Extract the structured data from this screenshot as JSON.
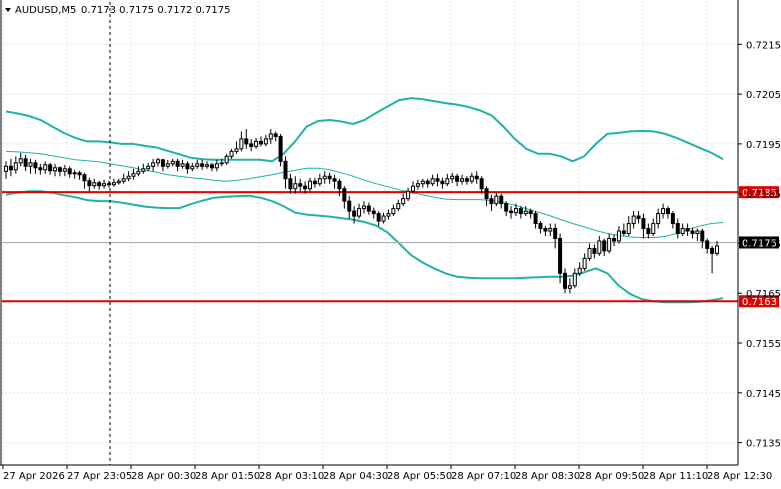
{
  "header": {
    "symbol": "AUDUSD,M5",
    "ohlc": "0.7173 0.7175 0.7172 0.7175"
  },
  "colors": {
    "background": "#ffffff",
    "grid": "#c8c8c8",
    "candle": "#000000",
    "band": "#20b2aa",
    "level": "#e00000",
    "current_bg": "#000000"
  },
  "chart_data": {
    "type": "candlestick",
    "grid": true,
    "ylim": [
      0.71305,
      0.72235
    ],
    "y_ticks": [
      "0.7215",
      "0.7205",
      "0.7195",
      "0.7185",
      "0.7175",
      "0.7165",
      "0.7155",
      "0.7145",
      "0.7135"
    ],
    "x_tick_labels": [
      "27 Apr 2026",
      "27 Apr 23:05",
      "28 Apr 00:30",
      "28 Apr 01:50",
      "28 Apr 03:10",
      "28 Apr 04:30",
      "28 Apr 05:50",
      "28 Apr 07:10",
      "28 Apr 08:30",
      "28 Apr 09:50",
      "28 Apr 11:10",
      "28 Apr 12:30"
    ],
    "levels": [
      {
        "label": "0.7185",
        "value": 0.71853
      },
      {
        "label": "0.7163",
        "value": 0.71634
      }
    ],
    "current_price": {
      "label": "0.7175",
      "value": 0.71752
    },
    "bollinger": {
      "upper": [
        0.72015,
        0.72011,
        0.72006,
        0.71998,
        0.71985,
        0.71972,
        0.71962,
        0.71955,
        0.71955,
        0.71953,
        0.7195,
        0.7195,
        0.71946,
        0.71943,
        0.71936,
        0.71929,
        0.71922,
        0.71919,
        0.71918,
        0.71918,
        0.71918,
        0.71918,
        0.71918,
        0.71915,
        0.7193,
        0.71955,
        0.71985,
        0.71996,
        0.71998,
        0.71995,
        0.7199,
        0.71998,
        0.72012,
        0.72025,
        0.72038,
        0.72042,
        0.7204,
        0.72036,
        0.72032,
        0.72029,
        0.72024,
        0.72017,
        0.72007,
        0.71985,
        0.7196,
        0.7194,
        0.7193,
        0.7193,
        0.71925,
        0.71915,
        0.71925,
        0.7195,
        0.7197,
        0.71972,
        0.71975,
        0.71976,
        0.71975,
        0.7197,
        0.71962,
        0.71952,
        0.71942,
        0.71932,
        0.71919
      ],
      "middle": [
        0.71935,
        0.71934,
        0.71932,
        0.7193,
        0.71926,
        0.71922,
        0.71918,
        0.71916,
        0.71914,
        0.7191,
        0.71906,
        0.71902,
        0.71897,
        0.71893,
        0.71888,
        0.71885,
        0.71882,
        0.7188,
        0.71877,
        0.71875,
        0.71877,
        0.7188,
        0.71884,
        0.71888,
        0.71893,
        0.71897,
        0.71901,
        0.71901,
        0.71898,
        0.71892,
        0.71885,
        0.71877,
        0.7187,
        0.71864,
        0.71858,
        0.71853,
        0.71848,
        0.71843,
        0.71839,
        0.71838,
        0.71838,
        0.71838,
        0.71836,
        0.71832,
        0.71827,
        0.7182,
        0.71813,
        0.71806,
        0.71798,
        0.7179,
        0.71783,
        0.71776,
        0.7177,
        0.71766,
        0.71763,
        0.71762,
        0.71762,
        0.71764,
        0.7177,
        0.71778,
        0.71785,
        0.7179,
        0.71792
      ],
      "lower": [
        0.71848,
        0.71852,
        0.71855,
        0.71855,
        0.71852,
        0.71847,
        0.71843,
        0.71837,
        0.71835,
        0.71835,
        0.71832,
        0.71828,
        0.71824,
        0.71822,
        0.71821,
        0.71821,
        0.71829,
        0.71836,
        0.71842,
        0.71844,
        0.71845,
        0.71846,
        0.71842,
        0.71835,
        0.71825,
        0.71812,
        0.71808,
        0.71806,
        0.71804,
        0.71801,
        0.71798,
        0.71793,
        0.71786,
        0.71772,
        0.7175,
        0.71727,
        0.71712,
        0.717,
        0.7169,
        0.71683,
        0.71681,
        0.7168,
        0.7168,
        0.7168,
        0.7168,
        0.71681,
        0.71682,
        0.71683,
        0.71683,
        0.71685,
        0.71692,
        0.717,
        0.7169,
        0.71665,
        0.71648,
        0.71638,
        0.71634,
        0.71632,
        0.71632,
        0.71632,
        0.71633,
        0.71636,
        0.7164
      ]
    },
    "candles": [
      [
        0.71895,
        0.71905,
        0.71915,
        0.7188
      ],
      [
        0.71905,
        0.71898,
        0.7192,
        0.71885
      ],
      [
        0.71898,
        0.71912,
        0.71925,
        0.7189
      ],
      [
        0.71912,
        0.7192,
        0.71932,
        0.71905
      ],
      [
        0.7192,
        0.71905,
        0.71928,
        0.71895
      ],
      [
        0.71905,
        0.71912,
        0.7192,
        0.7189
      ],
      [
        0.71912,
        0.71902,
        0.71918,
        0.7189
      ],
      [
        0.71902,
        0.71898,
        0.7191,
        0.71888
      ],
      [
        0.71898,
        0.71908,
        0.71915,
        0.7189
      ],
      [
        0.71908,
        0.71896,
        0.71912,
        0.71888
      ],
      [
        0.71896,
        0.71902,
        0.7191,
        0.71885
      ],
      [
        0.71902,
        0.71895,
        0.71905,
        0.71885
      ],
      [
        0.71895,
        0.719,
        0.71908,
        0.71885
      ],
      [
        0.719,
        0.7189,
        0.71905,
        0.71882
      ],
      [
        0.7189,
        0.71892,
        0.71898,
        0.7188
      ],
      [
        0.71892,
        0.71888,
        0.71896,
        0.71878
      ],
      [
        0.71888,
        0.71876,
        0.71892,
        0.7186
      ],
      [
        0.71876,
        0.71866,
        0.71882,
        0.71855
      ],
      [
        0.71866,
        0.71872,
        0.7188,
        0.7186
      ],
      [
        0.71872,
        0.71866,
        0.71876,
        0.71858
      ],
      [
        0.71866,
        0.7187,
        0.71878,
        0.7186
      ],
      [
        0.7187,
        0.71868,
        0.71876,
        0.71862
      ],
      [
        0.71868,
        0.71872,
        0.7188,
        0.71864
      ],
      [
        0.71872,
        0.71875,
        0.7188,
        0.71868
      ],
      [
        0.71875,
        0.7188,
        0.7189,
        0.7187
      ],
      [
        0.7188,
        0.71885,
        0.71895,
        0.71875
      ],
      [
        0.71885,
        0.7189,
        0.719,
        0.71878
      ],
      [
        0.7189,
        0.71895,
        0.71905,
        0.71885
      ],
      [
        0.71895,
        0.719,
        0.7191,
        0.7189
      ],
      [
        0.719,
        0.71905,
        0.71912,
        0.71895
      ],
      [
        0.71905,
        0.71912,
        0.7192,
        0.71895
      ],
      [
        0.71912,
        0.71918,
        0.71922,
        0.71905
      ],
      [
        0.71918,
        0.71905,
        0.7192,
        0.71895
      ],
      [
        0.71905,
        0.7191,
        0.71918,
        0.719
      ],
      [
        0.7191,
        0.71915,
        0.7192,
        0.71905
      ],
      [
        0.71915,
        0.71905,
        0.7192,
        0.71895
      ],
      [
        0.71905,
        0.7191,
        0.71918,
        0.719
      ],
      [
        0.7191,
        0.719,
        0.71915,
        0.7189
      ],
      [
        0.719,
        0.71905,
        0.71912,
        0.71895
      ],
      [
        0.71905,
        0.7191,
        0.71918,
        0.719
      ],
      [
        0.7191,
        0.71905,
        0.71918,
        0.71898
      ],
      [
        0.71905,
        0.71908,
        0.71915,
        0.719
      ],
      [
        0.71908,
        0.71902,
        0.71912,
        0.71895
      ],
      [
        0.71902,
        0.7191,
        0.71918,
        0.71895
      ],
      [
        0.7191,
        0.71912,
        0.7192,
        0.71905
      ],
      [
        0.71912,
        0.71925,
        0.7193,
        0.71908
      ],
      [
        0.71925,
        0.71935,
        0.7194,
        0.7192
      ],
      [
        0.71935,
        0.7194,
        0.71955,
        0.7193
      ],
      [
        0.7194,
        0.7196,
        0.71975,
        0.71935
      ],
      [
        0.7196,
        0.7195,
        0.7198,
        0.7194
      ],
      [
        0.7195,
        0.71945,
        0.7196,
        0.71935
      ],
      [
        0.71945,
        0.71955,
        0.71962,
        0.7194
      ],
      [
        0.71955,
        0.7195,
        0.71965,
        0.71945
      ],
      [
        0.7195,
        0.7196,
        0.71968,
        0.71945
      ],
      [
        0.7196,
        0.7197,
        0.7198,
        0.7195
      ],
      [
        0.7197,
        0.71965,
        0.71975,
        0.71955
      ],
      [
        0.71965,
        0.71915,
        0.7197,
        0.71905
      ],
      [
        0.71915,
        0.7188,
        0.71925,
        0.7186
      ],
      [
        0.7188,
        0.7186,
        0.7189,
        0.7185
      ],
      [
        0.7186,
        0.7187,
        0.71885,
        0.7185
      ],
      [
        0.7187,
        0.71865,
        0.7188,
        0.71855
      ],
      [
        0.71865,
        0.7186,
        0.71875,
        0.7185
      ],
      [
        0.7186,
        0.71875,
        0.71882,
        0.71855
      ],
      [
        0.71875,
        0.7187,
        0.71882,
        0.71862
      ],
      [
        0.7187,
        0.7188,
        0.7189,
        0.71865
      ],
      [
        0.7188,
        0.71885,
        0.71895,
        0.7187
      ],
      [
        0.71885,
        0.7188,
        0.71892,
        0.7187
      ],
      [
        0.7188,
        0.71875,
        0.71888,
        0.7186
      ],
      [
        0.71875,
        0.7186,
        0.7188,
        0.71845
      ],
      [
        0.7186,
        0.71835,
        0.71865,
        0.7182
      ],
      [
        0.71835,
        0.71815,
        0.71845,
        0.718
      ],
      [
        0.71815,
        0.71805,
        0.71825,
        0.7179
      ],
      [
        0.71805,
        0.7182,
        0.7183,
        0.718
      ],
      [
        0.7182,
        0.71825,
        0.71835,
        0.7181
      ],
      [
        0.71825,
        0.71815,
        0.71832,
        0.71808
      ],
      [
        0.71815,
        0.7181,
        0.71822,
        0.718
      ],
      [
        0.7181,
        0.71795,
        0.71815,
        0.71785
      ],
      [
        0.71795,
        0.71805,
        0.71812,
        0.7179
      ],
      [
        0.71805,
        0.7181,
        0.71818,
        0.71798
      ],
      [
        0.7181,
        0.7182,
        0.71828,
        0.71805
      ],
      [
        0.7182,
        0.7183,
        0.71838,
        0.71815
      ],
      [
        0.7183,
        0.7184,
        0.7185,
        0.71825
      ],
      [
        0.7184,
        0.71855,
        0.71862,
        0.71835
      ],
      [
        0.71855,
        0.71865,
        0.71875,
        0.7185
      ],
      [
        0.71865,
        0.7187,
        0.71878,
        0.71858
      ],
      [
        0.7187,
        0.71875,
        0.7188,
        0.71862
      ],
      [
        0.71875,
        0.7187,
        0.7188,
        0.71862
      ],
      [
        0.7187,
        0.7188,
        0.71888,
        0.71865
      ],
      [
        0.7188,
        0.71875,
        0.7189,
        0.71865
      ],
      [
        0.71875,
        0.7187,
        0.71882,
        0.7186
      ],
      [
        0.7187,
        0.7188,
        0.7189,
        0.71865
      ],
      [
        0.7188,
        0.71885,
        0.71892,
        0.71872
      ],
      [
        0.71885,
        0.71875,
        0.7189,
        0.71865
      ],
      [
        0.71875,
        0.7188,
        0.71888,
        0.71868
      ],
      [
        0.7188,
        0.71875,
        0.71885,
        0.71868
      ],
      [
        0.71875,
        0.71885,
        0.71892,
        0.7187
      ],
      [
        0.71885,
        0.7188,
        0.71895,
        0.7187
      ],
      [
        0.7188,
        0.7186,
        0.71885,
        0.7185
      ],
      [
        0.7186,
        0.7184,
        0.71865,
        0.71825
      ],
      [
        0.7184,
        0.7183,
        0.71848,
        0.71815
      ],
      [
        0.7183,
        0.71845,
        0.71852,
        0.71825
      ],
      [
        0.71845,
        0.7183,
        0.7185,
        0.7182
      ],
      [
        0.7183,
        0.71815,
        0.71835,
        0.71805
      ],
      [
        0.71815,
        0.71812,
        0.71825,
        0.718
      ],
      [
        0.71812,
        0.7182,
        0.7183,
        0.71805
      ],
      [
        0.7182,
        0.7181,
        0.71825,
        0.718
      ],
      [
        0.7181,
        0.71815,
        0.71825,
        0.71805
      ],
      [
        0.71815,
        0.7181,
        0.7182,
        0.718
      ],
      [
        0.7181,
        0.7179,
        0.71815,
        0.7178
      ],
      [
        0.7179,
        0.7178,
        0.71795,
        0.7177
      ],
      [
        0.7178,
        0.71775,
        0.71785,
        0.71765
      ],
      [
        0.71775,
        0.7178,
        0.7179,
        0.71765
      ],
      [
        0.7178,
        0.7176,
        0.7179,
        0.7174
      ],
      [
        0.7176,
        0.7169,
        0.7177,
        0.7167
      ],
      [
        0.7169,
        0.7166,
        0.717,
        0.7165
      ],
      [
        0.7166,
        0.71665,
        0.7168,
        0.7165
      ],
      [
        0.71665,
        0.7169,
        0.717,
        0.7166
      ],
      [
        0.7169,
        0.717,
        0.71712,
        0.71685
      ],
      [
        0.717,
        0.7172,
        0.7173,
        0.71695
      ],
      [
        0.7172,
        0.7174,
        0.7175,
        0.71715
      ],
      [
        0.7174,
        0.7173,
        0.71748,
        0.7172
      ],
      [
        0.7173,
        0.71755,
        0.71765,
        0.71725
      ],
      [
        0.71755,
        0.71735,
        0.7176,
        0.71725
      ],
      [
        0.71735,
        0.7176,
        0.7177,
        0.7173
      ],
      [
        0.7176,
        0.71755,
        0.71768,
        0.71745
      ],
      [
        0.71755,
        0.71775,
        0.71785,
        0.7175
      ],
      [
        0.71775,
        0.7177,
        0.7179,
        0.71765
      ],
      [
        0.7177,
        0.7179,
        0.71805,
        0.71765
      ],
      [
        0.7179,
        0.71805,
        0.71815,
        0.7178
      ],
      [
        0.71805,
        0.718,
        0.71815,
        0.7179
      ],
      [
        0.718,
        0.7178,
        0.7181,
        0.7176
      ],
      [
        0.7178,
        0.7177,
        0.7179,
        0.7176
      ],
      [
        0.7177,
        0.7179,
        0.718,
        0.71765
      ],
      [
        0.7179,
        0.7181,
        0.7182,
        0.7178
      ],
      [
        0.7181,
        0.7182,
        0.7183,
        0.718
      ],
      [
        0.7182,
        0.7181,
        0.71825,
        0.718
      ],
      [
        0.7181,
        0.7179,
        0.71815,
        0.7178
      ],
      [
        0.7179,
        0.7177,
        0.718,
        0.7176
      ],
      [
        0.7177,
        0.7178,
        0.7179,
        0.71765
      ],
      [
        0.7178,
        0.71775,
        0.7179,
        0.71765
      ],
      [
        0.71775,
        0.7177,
        0.71782,
        0.7176
      ],
      [
        0.7177,
        0.71775,
        0.7178,
        0.71755
      ],
      [
        0.71775,
        0.71755,
        0.7178,
        0.7174
      ],
      [
        0.71755,
        0.7174,
        0.7176,
        0.7173
      ],
      [
        0.7174,
        0.7173,
        0.71745,
        0.7169
      ],
      [
        0.7173,
        0.71745,
        0.71755,
        0.71725
      ]
    ]
  }
}
